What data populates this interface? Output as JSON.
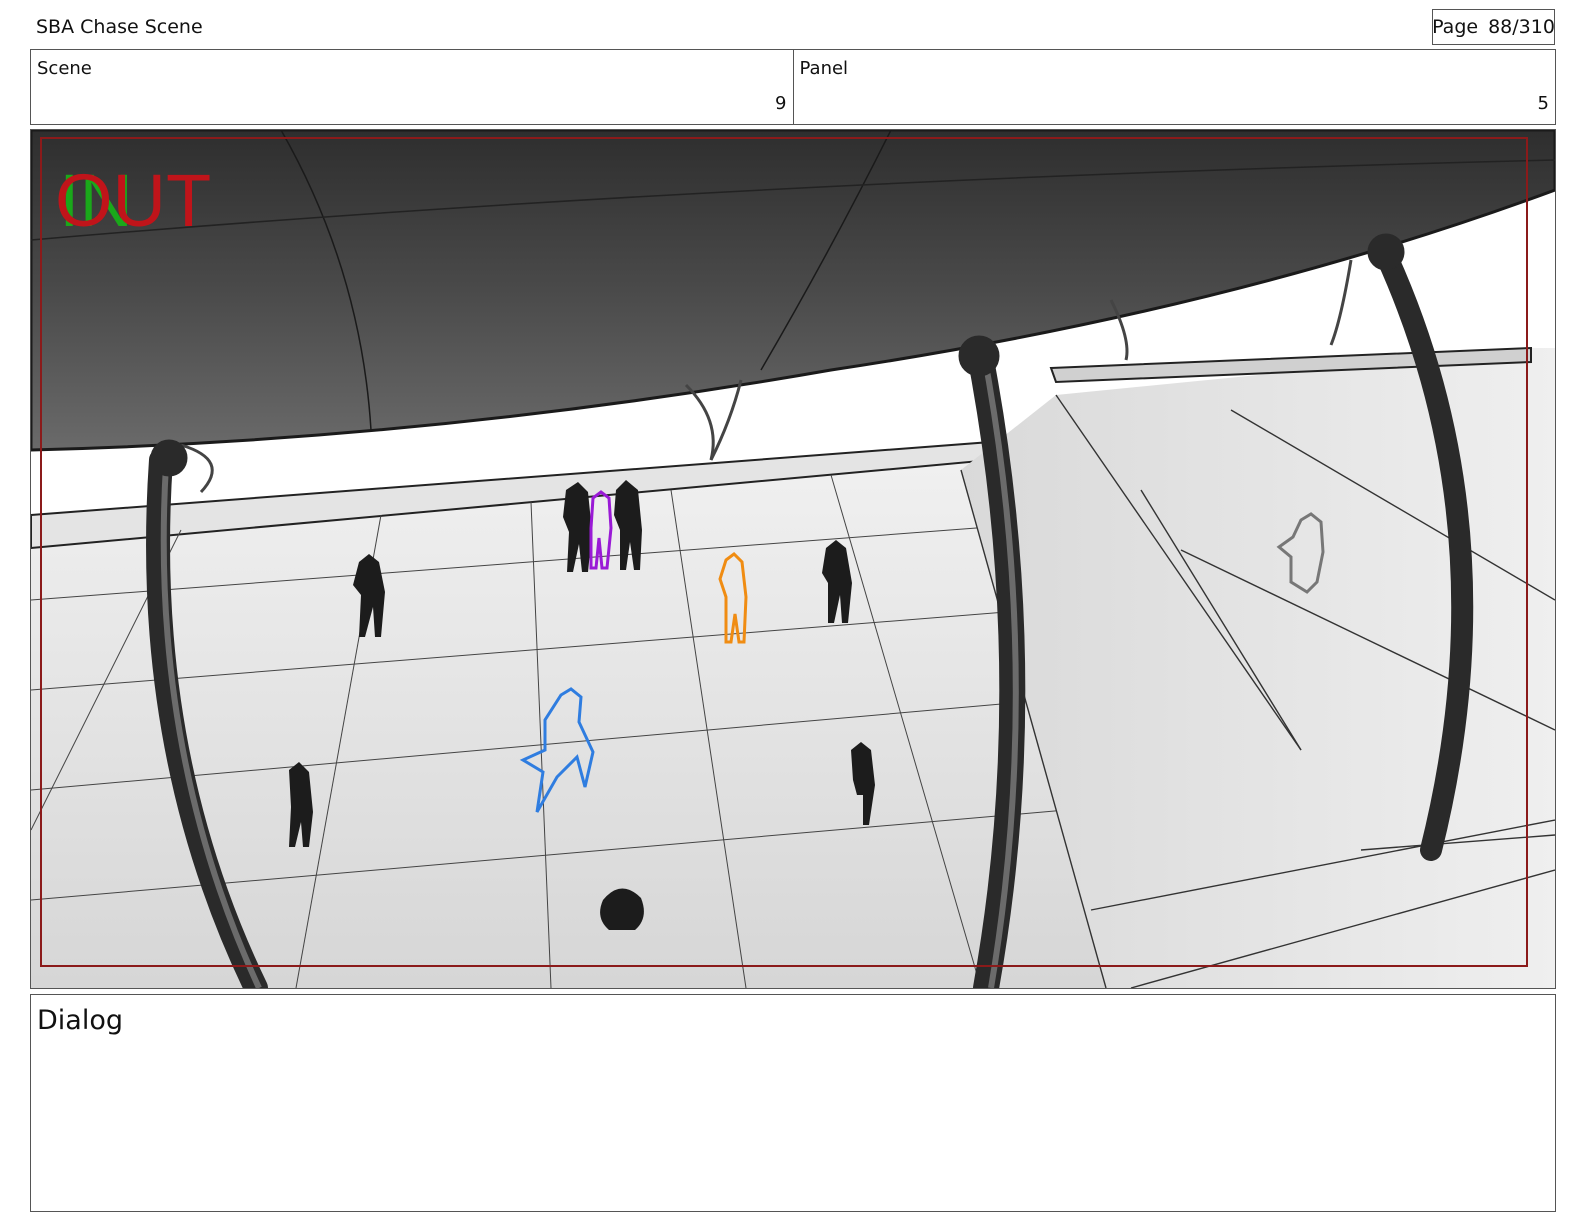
{
  "header": {
    "title": "SBA Chase Scene",
    "page_label": "Page",
    "page_value": "88/310"
  },
  "info": {
    "scene_label": "Scene",
    "scene_value": "9",
    "panel_label": "Panel",
    "panel_value": "5"
  },
  "panel": {
    "in_marker": "IN",
    "out_marker": "OUT",
    "in_color": "#1aa81a",
    "out_color": "#c0141a",
    "safe_frame_color": "#8b1a1a"
  },
  "dialog": {
    "label": "Dialog"
  }
}
